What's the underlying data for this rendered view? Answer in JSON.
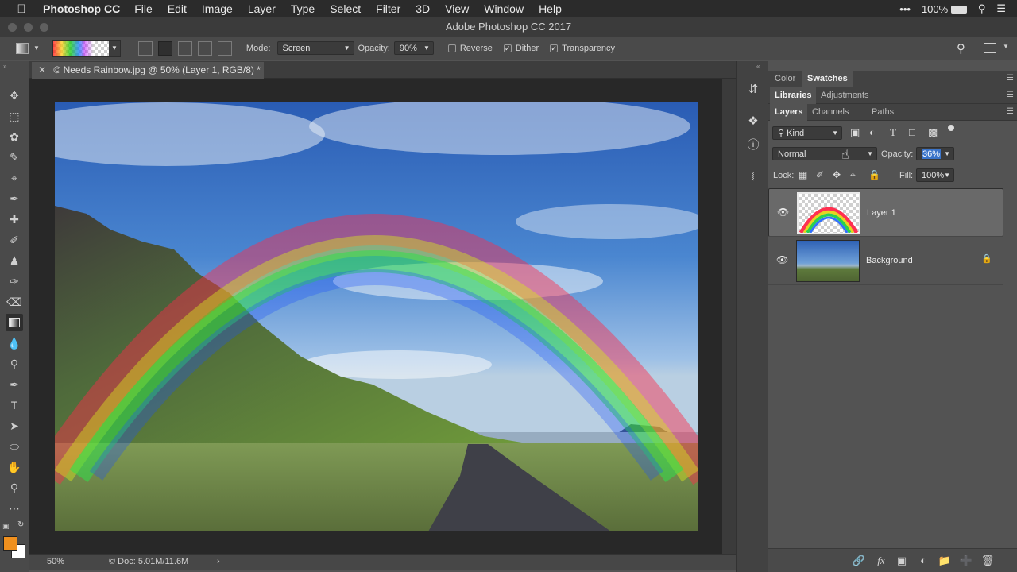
{
  "menubar": {
    "app": "Photoshop CC",
    "items": [
      "File",
      "Edit",
      "Image",
      "Layer",
      "Type",
      "Select",
      "Filter",
      "3D",
      "View",
      "Window",
      "Help"
    ],
    "right": {
      "more": "•••",
      "battery": "100%"
    }
  },
  "window": {
    "title": "Adobe Photoshop CC 2017"
  },
  "options": {
    "mode_label": "Mode:",
    "mode_value": "Screen",
    "opacity_label": "Opacity:",
    "opacity_value": "90%",
    "reverse": "Reverse",
    "dither": "Dither",
    "transparency": "Transparency",
    "reverse_checked": false,
    "dither_checked": true,
    "transparency_checked": true
  },
  "document": {
    "tab_title": "© Needs Rainbow.jpg @ 50% (Layer 1, RGB/8) *",
    "zoom": "50%",
    "doc_info": "© Doc: 5.01M/11.6M"
  },
  "panels": {
    "top_tabs": [
      {
        "label": "Color",
        "active": false
      },
      {
        "label": "Swatches",
        "active": true
      }
    ],
    "mid_tabs": [
      {
        "label": "Libraries",
        "active": true
      },
      {
        "label": "Adjustments",
        "active": false
      }
    ],
    "layer_tabs": [
      {
        "label": "Layers",
        "active": true
      },
      {
        "label": "Channels",
        "active": false
      },
      {
        "label": "Paths",
        "active": false
      }
    ],
    "filter_kind": "Kind",
    "blend_mode": "Normal",
    "opacity_label": "Opacity:",
    "opacity_value": "36%",
    "lock_label": "Lock:",
    "fill_label": "Fill:",
    "fill_value": "100%",
    "layers": [
      {
        "name": "Layer 1",
        "selected": true,
        "locked": false
      },
      {
        "name": "Background",
        "selected": false,
        "locked": true
      }
    ]
  },
  "colors": {
    "foreground": "#f0901e",
    "background": "#ffffff"
  }
}
